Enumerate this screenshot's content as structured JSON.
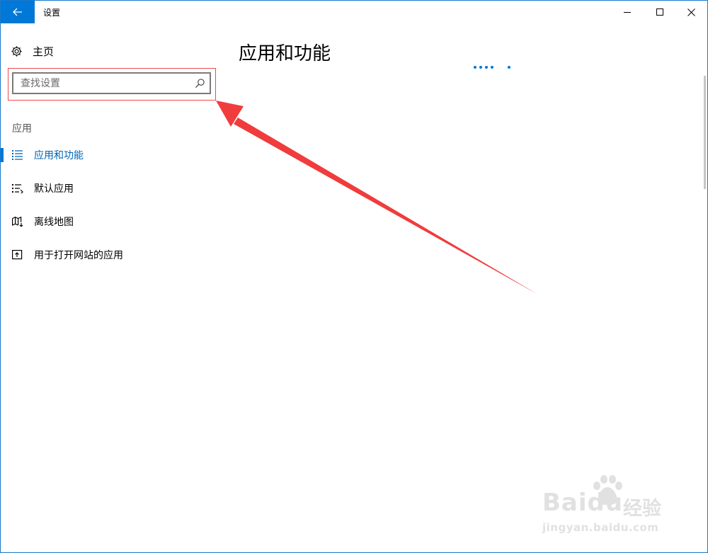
{
  "window": {
    "title": "设置",
    "accent_color": "#0078d7",
    "controls": [
      "minimize-icon",
      "maximize-icon",
      "close-icon"
    ]
  },
  "sidebar": {
    "home_label": "主页",
    "search": {
      "placeholder": "查找设置",
      "value": ""
    },
    "section_label": "应用",
    "items": [
      {
        "label": "应用和功能",
        "icon": "apps-features-icon",
        "active": true
      },
      {
        "label": "默认应用",
        "icon": "default-apps-icon",
        "active": false
      },
      {
        "label": "离线地图",
        "icon": "offline-maps-icon",
        "active": false
      },
      {
        "label": "用于打开网站的应用",
        "icon": "apps-for-websites-icon",
        "active": false
      }
    ]
  },
  "main": {
    "page_title": "应用和功能",
    "loading_indicator": "loading-dots"
  },
  "annotation": {
    "highlight_color": "#ef4a4a",
    "target": "search-box"
  },
  "watermark": {
    "brand": "Baidu",
    "brand_cn": "经验",
    "url": "jingyan.baidu.com"
  }
}
